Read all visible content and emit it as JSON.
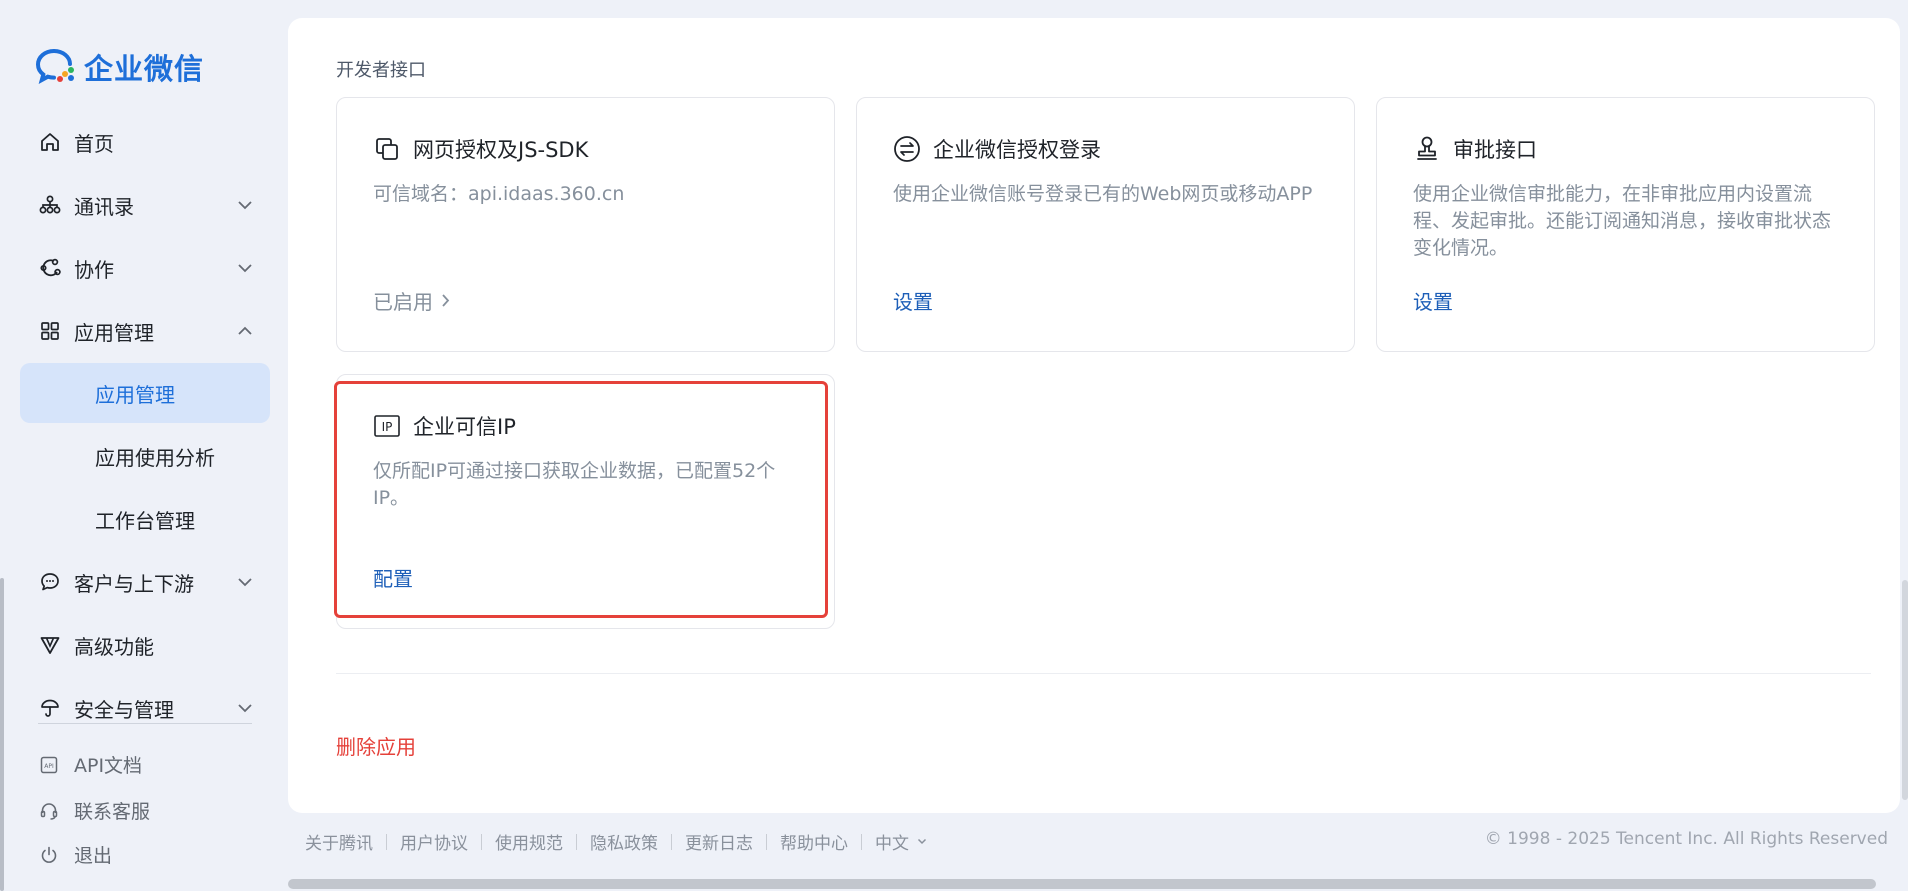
{
  "app": {
    "logo_text": "企业微信"
  },
  "sidebar": {
    "items": [
      {
        "label": "首页",
        "icon": "home-icon"
      },
      {
        "label": "通讯录",
        "icon": "org-chart-icon"
      },
      {
        "label": "协作",
        "icon": "collaboration-icon"
      },
      {
        "label": "应用管理",
        "icon": "grid-icon"
      },
      {
        "label": "应用管理"
      },
      {
        "label": "应用使用分析"
      },
      {
        "label": "工作台管理"
      },
      {
        "label": "客户与上下游",
        "icon": "chat-bubble-icon"
      },
      {
        "label": "高级功能",
        "icon": "v-shield-icon"
      },
      {
        "label": "安全与管理",
        "icon": "umbrella-icon"
      }
    ],
    "bottom": [
      {
        "label": "API文档",
        "icon": "api-doc-icon"
      },
      {
        "label": "联系客服",
        "icon": "headset-icon"
      },
      {
        "label": "退出",
        "icon": "power-icon"
      }
    ]
  },
  "main": {
    "section_title": "开发者接口",
    "cards": [
      {
        "title": "网页授权及JS-SDK",
        "icon": "overlap-squares-icon",
        "desc": "可信域名：api.idaas.360.cn",
        "status": "已启用"
      },
      {
        "title": "企业微信授权登录",
        "icon": "exchange-circle-icon",
        "desc": "使用企业微信账号登录已有的Web网页或移动APP",
        "link": "设置"
      },
      {
        "title": "审批接口",
        "icon": "stamp-icon",
        "desc": "使用企业微信审批能力，在非审批应用内设置流程、发起审批。还能订阅通知消息，接收审批状态变化情况。",
        "link": "设置"
      },
      {
        "title": "企业可信IP",
        "icon": "ip-badge-icon",
        "desc": "仅所配IP可通过接口获取企业数据，已配置52个IP。",
        "link": "配置"
      }
    ],
    "delete_label": "删除应用"
  },
  "footer": {
    "links": [
      "关于腾讯",
      "用户协议",
      "使用规范",
      "隐私政策",
      "更新日志",
      "帮助中心"
    ],
    "language": "中文",
    "copyright": "© 1998 - 2025 Tencent Inc. All Rights Reserved"
  },
  "colors": {
    "accent": "#1e6fd9",
    "link": "#1e5fb8",
    "danger": "#e5413a",
    "active_bg": "#d6e4fa"
  }
}
